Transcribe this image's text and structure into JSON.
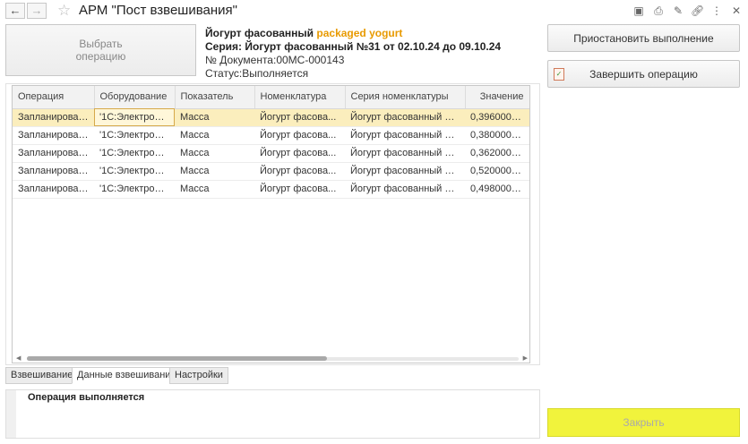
{
  "window": {
    "title": "АРМ \"Пост взвешивания\"",
    "back_icon": "arrow-left-icon",
    "forward_icon": "arrow-right-icon"
  },
  "select_operation": {
    "line1": "Выбрать",
    "line2": "операцию"
  },
  "info": {
    "product": "Йогурт фасованный",
    "product_extra": "packaged yogurt",
    "series": "Серия: Йогурт фасованный №31 от 02.10.24 до 09.10.24",
    "document": "№ Документа:00МС-000143",
    "status": "Статус:Выполняется"
  },
  "actions": {
    "pause": "Приостановить выполнение",
    "finish": "Завершить операцию",
    "close": "Закрыть"
  },
  "table": {
    "columns": [
      "Операция",
      "Оборудование",
      "Показатель",
      "Номенклатура",
      "Серия номенклатуры",
      "Значение"
    ],
    "rows": [
      [
        "Запланированн...",
        "'1С:Электронн...",
        "Масса",
        "Йогурт фасова...",
        "Йогурт фасованный №...",
        "0,396000000"
      ],
      [
        "Запланированн...",
        "'1С:Электронн...",
        "Масса",
        "Йогурт фасова...",
        "Йогурт фасованный №...",
        "0,380000000"
      ],
      [
        "Запланированн...",
        "'1С:Электронн...",
        "Масса",
        "Йогурт фасова...",
        "Йогурт фасованный №...",
        "0,362000000"
      ],
      [
        "Запланированн...",
        "'1С:Электронн...",
        "Масса",
        "Йогурт фасова...",
        "Йогурт фасованный №...",
        "0,520000000"
      ],
      [
        "Запланированн...",
        "'1С:Электронн...",
        "Масса",
        "Йогурт фасова...",
        "Йогурт фасованный №...",
        "0,498000000"
      ]
    ]
  },
  "tabs": [
    "Взвешивание",
    "Данные взвешивания",
    "Настройки"
  ],
  "status_panel": {
    "message": "Операция выполняется"
  },
  "colors": {
    "accent_text": "#e89a00",
    "selected_row": "#fbeebd",
    "close_button": "#f1f33c"
  }
}
